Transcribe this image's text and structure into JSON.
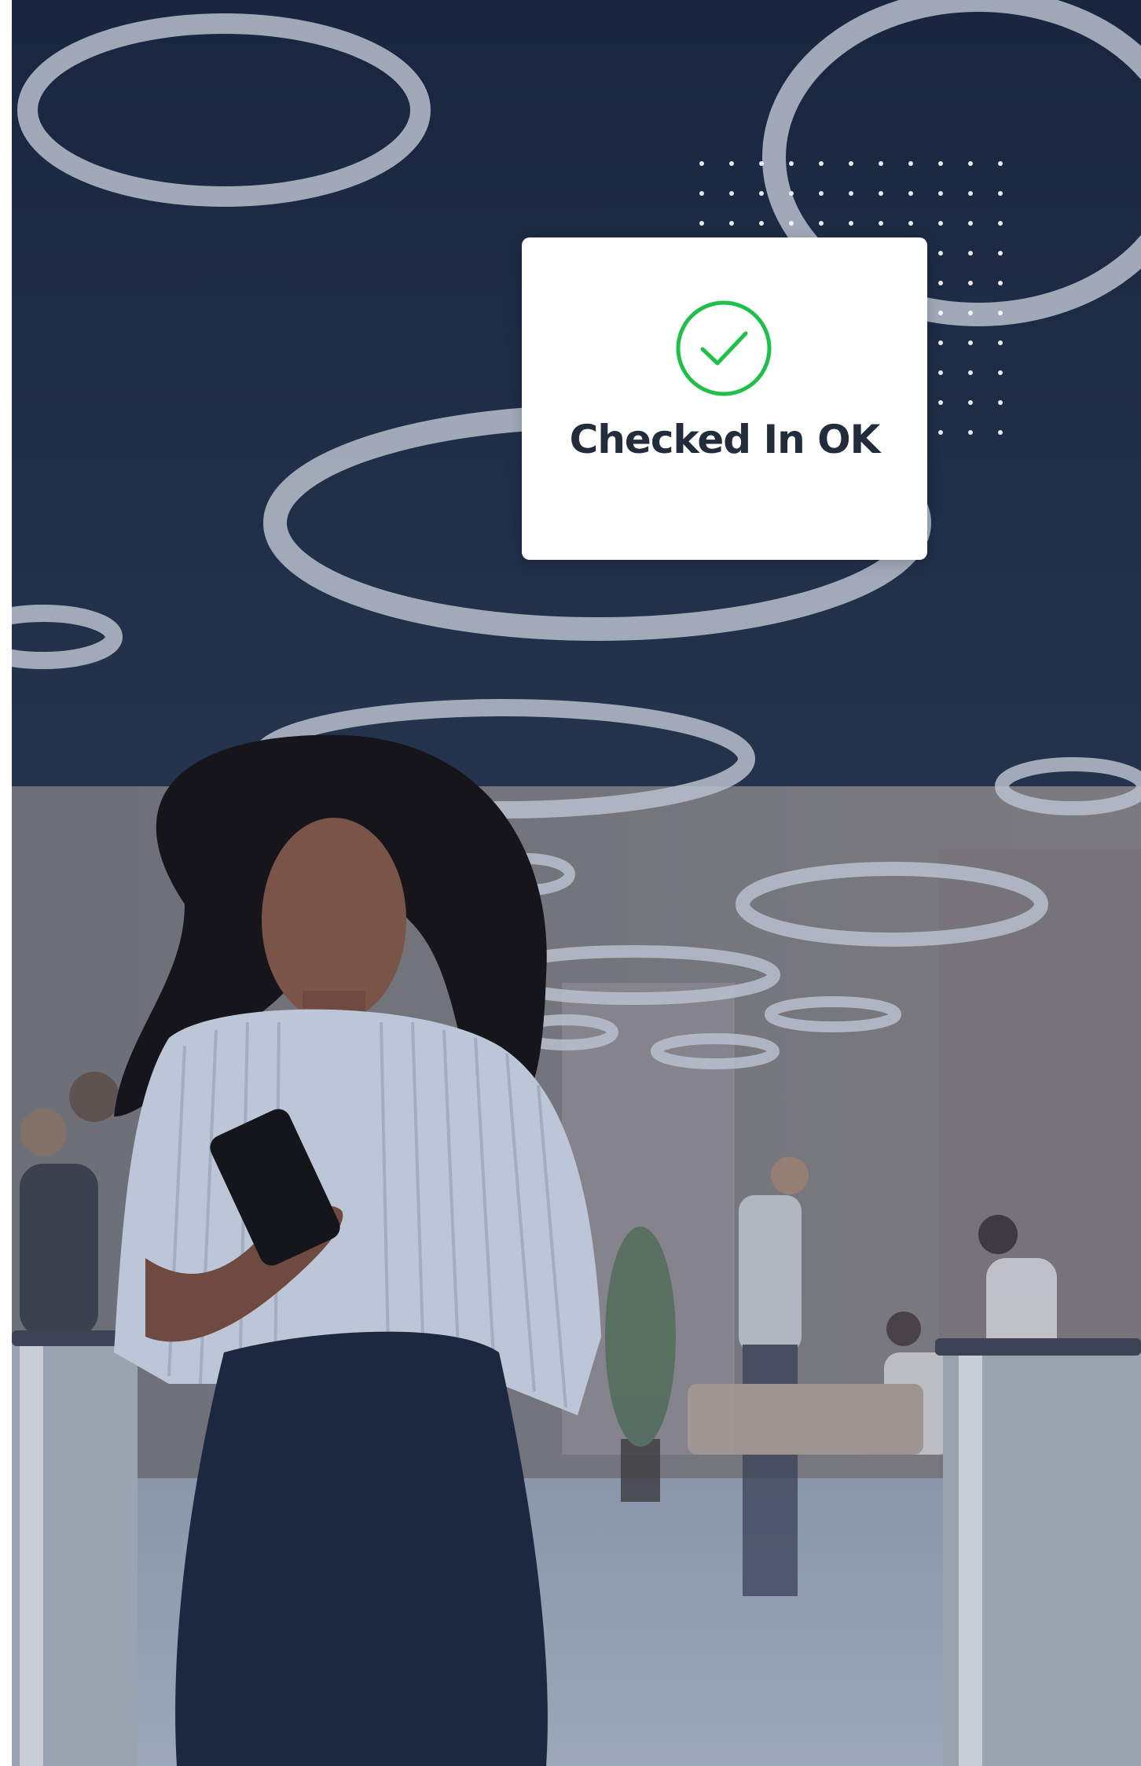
{
  "status_card": {
    "label": "Checked In OK",
    "icon": "check-circle-icon",
    "accent_color": "#1fbf4a"
  },
  "photo": {
    "subject": "office-lobby-photo"
  }
}
